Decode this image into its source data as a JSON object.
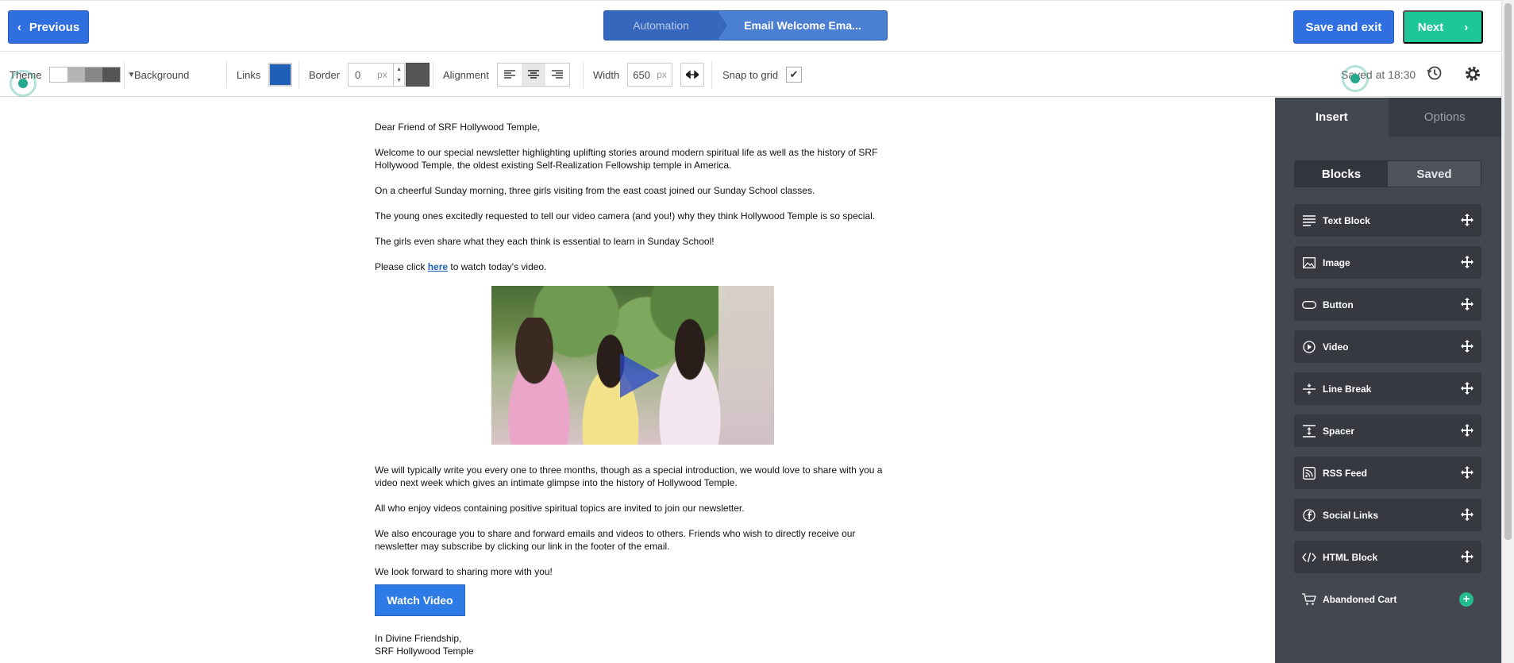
{
  "header": {
    "previous_label": "Previous",
    "breadcrumbs": [
      {
        "label": "Automation"
      },
      {
        "label": "Email Welcome Ema..."
      }
    ],
    "save_exit_label": "Save and exit",
    "next_label": "Next"
  },
  "toolbar": {
    "theme_label": "Theme",
    "theme_colors": [
      "#ffffff",
      "#b5b5b5",
      "#888888",
      "#555555"
    ],
    "background_label": "Background",
    "links_label": "Links",
    "links_color": "#1f5fb8",
    "border_label": "Border",
    "border_value": "0",
    "border_unit": "px",
    "border_color": "#555555",
    "alignment_label": "Alignment",
    "alignment_selected": "center",
    "width_label": "Width",
    "width_value": "650",
    "width_unit": "px",
    "snap_label": "Snap to grid",
    "snap_checked": true,
    "saved_at": "Saved at 18:30"
  },
  "email": {
    "greeting": "Dear Friend of SRF Hollywood Temple,",
    "p1": "Welcome to our special newsletter highlighting uplifting stories around modern spiritual life as well as the history of SRF Hollywood Temple, the oldest existing Self-Realization Fellowship temple in America.",
    "p2": "On a cheerful Sunday morning, three girls visiting from the east coast joined our Sunday School classes.",
    "p3": "The young ones excitedly requested to tell our video camera (and you!) why they think Hollywood Temple is so special.",
    "p4": "The girls even share what they each think is essential to learn in Sunday School!",
    "p5_before": "Please click ",
    "p5_link": "here",
    "p5_after": " to watch today's video.",
    "p6": "We will typically write you every one to three months, though as a special introduction, we would love to share with you a video next week which gives an intimate glimpse into the history of Hollywood Temple.",
    "p7": "All who enjoy videos containing positive spiritual topics are invited to join our newsletter.",
    "p8": "We also encourage you to share and forward emails and videos to others. Friends who wish to directly receive our newsletter may subscribe by clicking our link in the footer of the email.",
    "p9": "We look forward to sharing more with you!",
    "button_label": "Watch Video",
    "signoff_1": "In Divine Friendship,",
    "signoff_2": "SRF Hollywood Temple"
  },
  "panel": {
    "tabs": [
      {
        "label": "Insert",
        "active": true
      },
      {
        "label": "Options",
        "active": false
      }
    ],
    "segments": [
      {
        "label": "Blocks",
        "active": true
      },
      {
        "label": "Saved",
        "active": false
      }
    ],
    "blocks": [
      {
        "label": "Text Block",
        "icon": "text-lines-icon"
      },
      {
        "label": "Image",
        "icon": "image-icon"
      },
      {
        "label": "Button",
        "icon": "button-pill-icon"
      },
      {
        "label": "Video",
        "icon": "play-circle-icon"
      },
      {
        "label": "Line Break",
        "icon": "line-break-icon"
      },
      {
        "label": "Spacer",
        "icon": "spacer-icon"
      },
      {
        "label": "RSS Feed",
        "icon": "rss-icon"
      },
      {
        "label": "Social Links",
        "icon": "facebook-icon"
      },
      {
        "label": "HTML Block",
        "icon": "code-icon"
      },
      {
        "label": "Abandoned Cart",
        "icon": "cart-icon"
      }
    ]
  }
}
